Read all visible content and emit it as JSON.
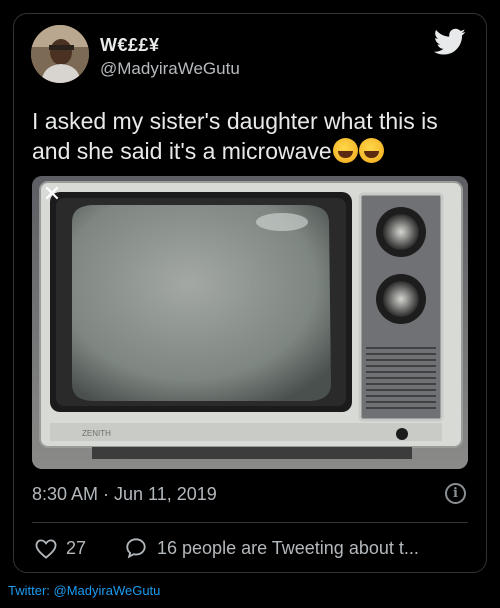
{
  "tweet": {
    "display_name": "W€££¥",
    "handle": "@MadyiraWeGutu",
    "text": "I asked my sister's daughter what this is and she said it's a microwave",
    "emoji": [
      "face-with-tears-of-joy",
      "face-with-tears-of-joy"
    ],
    "timestamp": "8:30 AM · Jun 11, 2019",
    "likes": "27",
    "people_tweeting": "16 people are Tweeting about t..."
  },
  "media": {
    "alt": "Vintage tube television with dials",
    "close_icon": "close-icon",
    "brand_text": "ZENITH"
  },
  "icons": {
    "brand": "twitter-bird-icon",
    "info": "info-icon",
    "like": "heart-icon",
    "reply": "speech-bubble-icon"
  },
  "credit": "Twitter: @MadyiraWeGutu",
  "colors": {
    "background": "#000000",
    "text": "#e7e9ea",
    "muted": "#b3b8bc",
    "accent": "#1d9bf0"
  }
}
